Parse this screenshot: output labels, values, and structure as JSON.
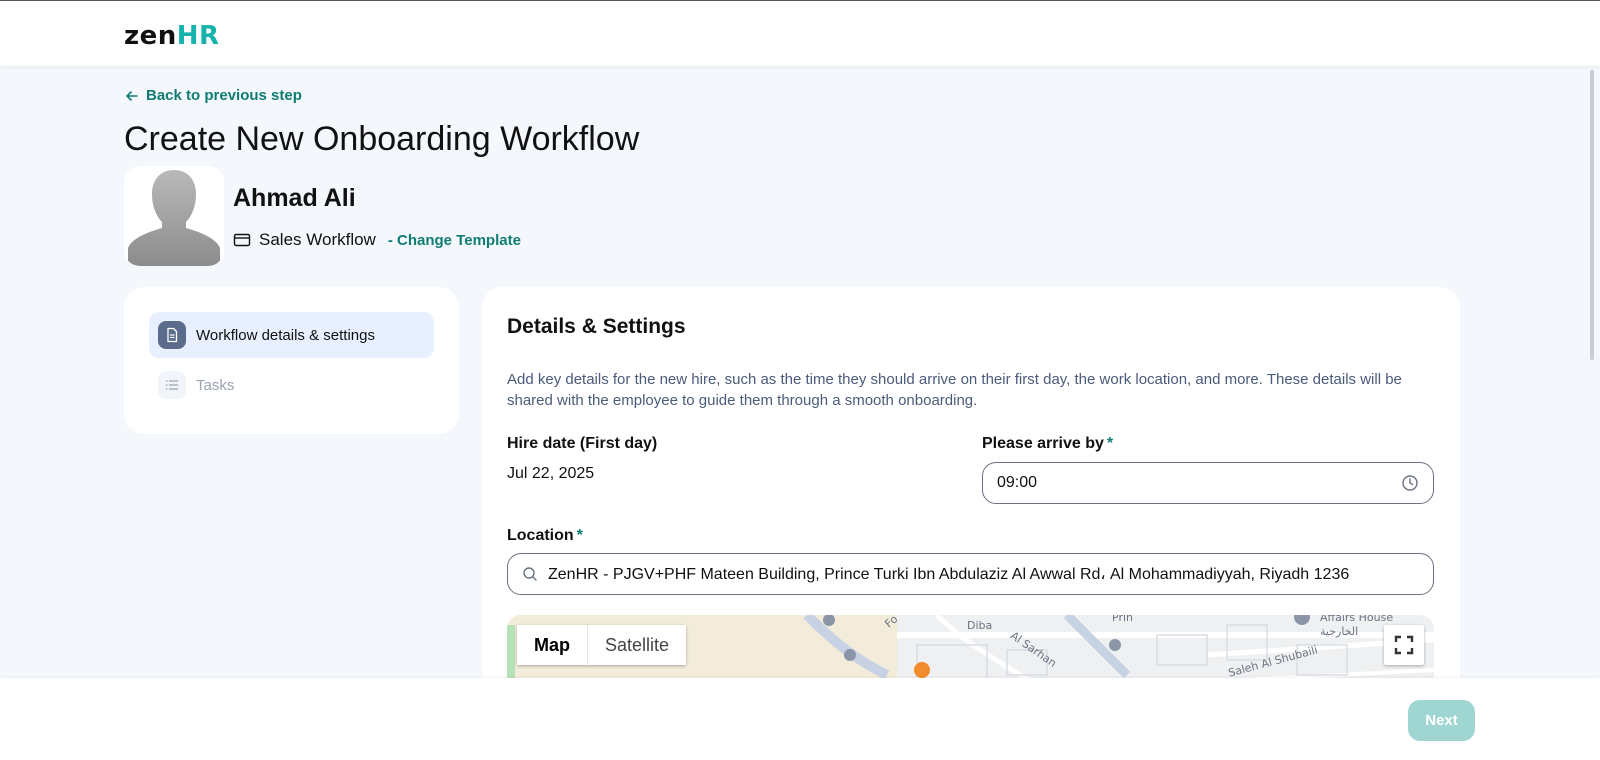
{
  "brand": {
    "logo_part1": "zen",
    "logo_part2": "HR",
    "accent": "#0f7d73"
  },
  "nav": {
    "back_label": "Back to previous step"
  },
  "page": {
    "title": "Create New Onboarding Workflow"
  },
  "employee": {
    "name": "Ahmad Ali",
    "template_name": "Sales Workflow",
    "change_template_label": "- Change Template"
  },
  "steps": [
    {
      "label": "Workflow details & settings",
      "icon": "document-icon",
      "active": true
    },
    {
      "label": "Tasks",
      "icon": "list-icon",
      "active": false
    }
  ],
  "details": {
    "title": "Details & Settings",
    "description": "Add key details for the new hire, such as the time they should arrive on their first day, the work location, and more. These details will be shared with the employee to guide them through a smooth onboarding.",
    "hire_date_label": "Hire date (First day)",
    "hire_date_value": "Jul 22, 2025",
    "arrive_label": "Please arrive by",
    "required_mark": "*",
    "arrive_value": "09:00",
    "location_label": "Location",
    "location_value": "ZenHR - PJGV+PHF Mateen Building, Prince Turki Ibn Abdulaziz Al Awwal Rd، Al Mohammadiyyah, Riyadh 1236"
  },
  "map": {
    "map_label": "Map",
    "satellite_label": "Satellite",
    "street_labels": [
      "Diba",
      "Al Sarhan",
      "Saleh Al Shubaili",
      "Affairs House",
      "الخارجية",
      "Fo",
      "Prin"
    ]
  },
  "footer": {
    "next_label": "Next"
  }
}
